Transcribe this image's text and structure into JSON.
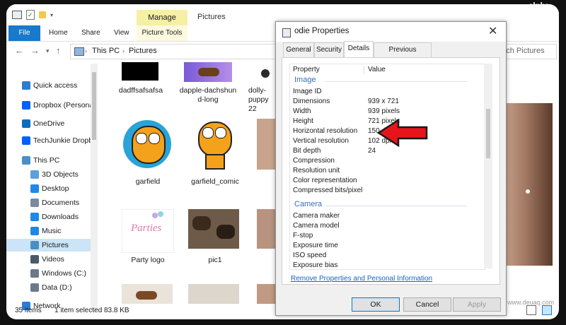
{
  "window": {
    "title": "Pictures",
    "manage_tab": "Manage"
  },
  "ribbon": {
    "tabs": [
      "File",
      "Home",
      "Share",
      "View"
    ],
    "context_tab": "Picture Tools"
  },
  "address": {
    "path": [
      "This PC",
      "Pictures"
    ],
    "search_placeholder": "Search Pictures"
  },
  "sidebar": {
    "items": [
      {
        "label": "Quick access",
        "icon": "star-icon",
        "color": "#2b7cd3"
      },
      {
        "label": "Dropbox (Persona",
        "icon": "dropbox-icon",
        "color": "#0061fe"
      },
      {
        "label": "OneDrive",
        "icon": "cloud-icon",
        "color": "#0f6cbd"
      },
      {
        "label": "TechJunkie Dropb",
        "icon": "dropbox-icon",
        "color": "#0061fe"
      },
      {
        "label": "This PC",
        "icon": "computer-icon",
        "color": "#4a90c2"
      },
      {
        "label": "3D Objects",
        "icon": "cube-icon",
        "color": "#5ea0d8"
      },
      {
        "label": "Desktop",
        "icon": "desktop-icon",
        "color": "#1e88e5"
      },
      {
        "label": "Documents",
        "icon": "documents-icon",
        "color": "#7a8aa0"
      },
      {
        "label": "Downloads",
        "icon": "download-icon",
        "color": "#1e88e5"
      },
      {
        "label": "Music",
        "icon": "music-icon",
        "color": "#1e88e5"
      },
      {
        "label": "Pictures",
        "icon": "pictures-icon",
        "color": "#4a90c2"
      },
      {
        "label": "Videos",
        "icon": "videos-icon",
        "color": "#4a5a6a"
      },
      {
        "label": "Windows (C:)",
        "icon": "drive-icon",
        "color": "#6a7a8a"
      },
      {
        "label": "Data (D:)",
        "icon": "drive-icon",
        "color": "#6a7a8a"
      },
      {
        "label": "Network",
        "icon": "network-icon",
        "color": "#2b7cd3"
      }
    ]
  },
  "files": [
    {
      "label": "dadffsafsafsa"
    },
    {
      "label": "dapple-dachshun d-long"
    },
    {
      "label": "dolly-puppy 22"
    },
    {
      "label": "garfield"
    },
    {
      "label": "garfield_comic"
    },
    {
      "label": "Party logo"
    },
    {
      "label": "pic1"
    }
  ],
  "status": {
    "count": "35 items",
    "selection": "1 item selected",
    "size": "83.8 KB"
  },
  "dialog": {
    "title": "odie Properties",
    "tabs": [
      "General",
      "Security",
      "Details",
      "Previous Versions"
    ],
    "columns": {
      "property": "Property",
      "value": "Value"
    },
    "groups": [
      {
        "name": "Image",
        "rows": [
          {
            "k": "Image ID",
            "v": ""
          },
          {
            "k": "Dimensions",
            "v": "939 x 721"
          },
          {
            "k": "Width",
            "v": "939 pixels"
          },
          {
            "k": "Height",
            "v": "721 pixels"
          },
          {
            "k": "Horizontal resolution",
            "v": "150 dpi"
          },
          {
            "k": "Vertical resolution",
            "v": "102 dpi"
          },
          {
            "k": "Bit depth",
            "v": "24"
          },
          {
            "k": "Compression",
            "v": ""
          },
          {
            "k": "Resolution unit",
            "v": ""
          },
          {
            "k": "Color representation",
            "v": ""
          },
          {
            "k": "Compressed bits/pixel",
            "v": ""
          }
        ]
      },
      {
        "name": "Camera",
        "rows": [
          {
            "k": "Camera maker",
            "v": ""
          },
          {
            "k": "Camera model",
            "v": ""
          },
          {
            "k": "F-stop",
            "v": ""
          },
          {
            "k": "Exposure time",
            "v": ""
          },
          {
            "k": "ISO speed",
            "v": ""
          },
          {
            "k": "Exposure bias",
            "v": ""
          }
        ]
      }
    ],
    "remove_link": "Remove Properties and Personal Information",
    "buttons": {
      "ok": "OK",
      "cancel": "Cancel",
      "apply": "Apply"
    }
  },
  "colors": {
    "accent": "#1979ca",
    "manage": "#f6f0a6",
    "arrow": "#e8141b"
  },
  "watermark": "alphr",
  "watermark2": "www.deuaq.com"
}
